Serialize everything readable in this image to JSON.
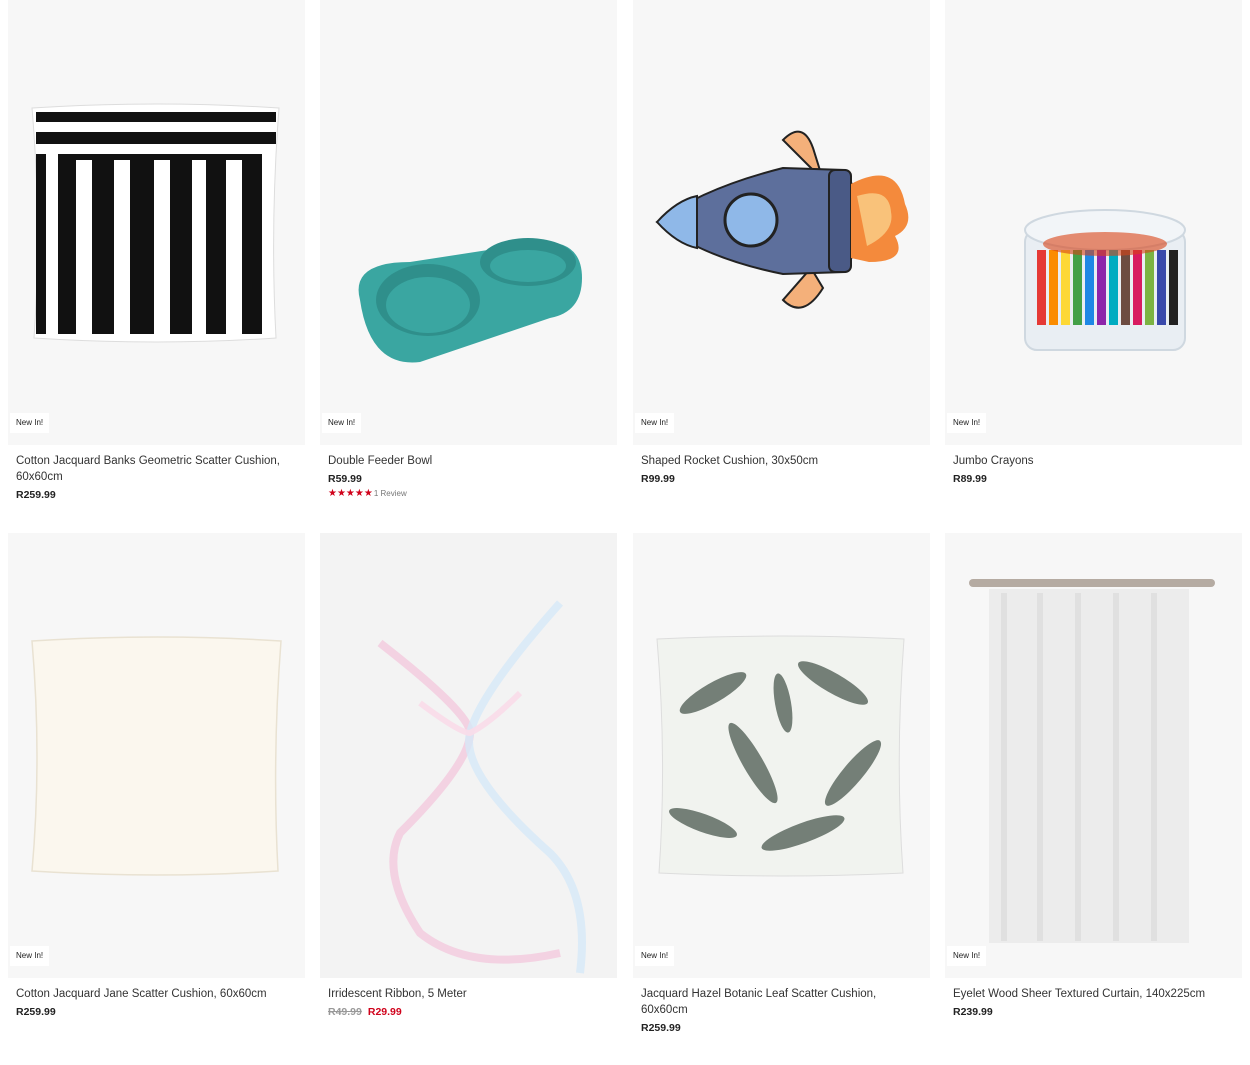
{
  "colors": {
    "sale": "#d0021b",
    "badge_bg": "#ffffff",
    "card_bg": "#f7f7f7"
  },
  "products": [
    {
      "name": "Cotton Jacquard Banks Geometric Scatter Cushion, 60x60cm",
      "price": "R259.99",
      "badge": "New In!",
      "image": "black-white-geometric-cushion"
    },
    {
      "name": "Double Feeder Bowl",
      "price": "R59.99",
      "badge": "New In!",
      "image": "teal-double-bowl",
      "rating": {
        "stars": 5,
        "text": "1 Review"
      }
    },
    {
      "name": "Shaped Rocket Cushion, 30x50cm",
      "price": "R99.99",
      "badge": "New In!",
      "image": "rocket-cushion"
    },
    {
      "name": "Jumbo Crayons",
      "price": "R89.99",
      "badge": "New In!",
      "image": "crayons-tub"
    },
    {
      "name": "Cotton Jacquard Jane Scatter Cushion, 60x60cm",
      "price": "R259.99",
      "badge": "New In!",
      "image": "cream-cushion"
    },
    {
      "name": "Irridescent Ribbon, 5 Meter",
      "price_old": "R49.99",
      "price": "R29.99",
      "image": "iridescent-ribbon"
    },
    {
      "name": "Jacquard Hazel Botanic Leaf Scatter Cushion, 60x60cm",
      "price": "R259.99",
      "badge": "New In!",
      "image": "leaf-print-cushion"
    },
    {
      "name": "Eyelet Wood Sheer Textured Curtain, 140x225cm",
      "price": "R239.99",
      "badge": "New In!",
      "image": "sheer-curtain"
    }
  ]
}
